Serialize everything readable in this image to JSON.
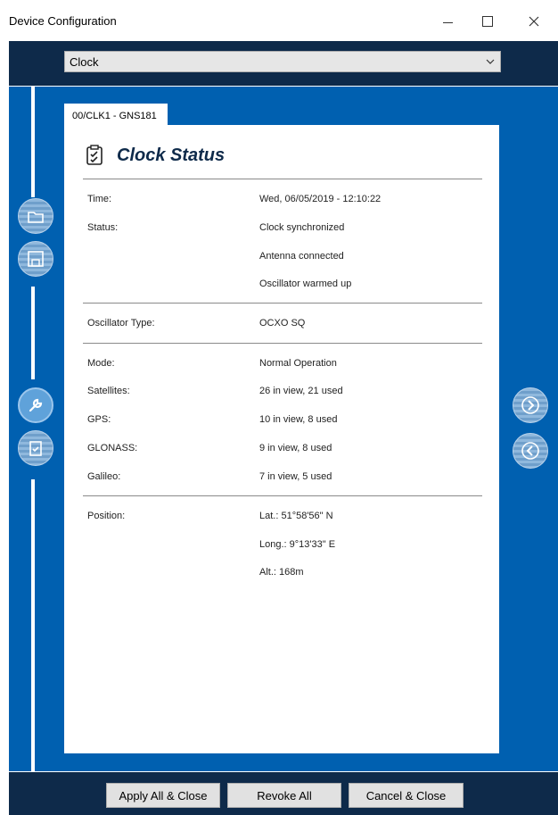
{
  "window": {
    "title": "Device Configuration"
  },
  "device_select": {
    "value": "Clock"
  },
  "tab": {
    "label": "00/CLK1 - GNS181"
  },
  "panel": {
    "title": "Clock Status"
  },
  "status": {
    "time_label": "Time:",
    "time_value": "Wed, 06/05/2019 - 12:10:22",
    "status_label": "Status:",
    "status_values": [
      "Clock synchronized",
      "Antenna connected",
      "Oscillator warmed up"
    ],
    "osc_label": "Oscillator Type:",
    "osc_value": "OCXO SQ",
    "mode_label": "Mode:",
    "mode_value": "Normal Operation",
    "sat_label": "Satellites:",
    "sat_value": "26 in view, 21 used",
    "gps_label": "GPS:",
    "gps_value": "10 in view, 8 used",
    "glonass_label": "GLONASS:",
    "glonass_value": "9 in view, 8 used",
    "galileo_label": "Galileo:",
    "galileo_value": "7 in view, 5 used",
    "pos_label": "Position:",
    "lat_value": "Lat.: 51°58'56\" N",
    "long_value": "Long.:  9°13'33\" E",
    "alt_value": "Alt.: 168m"
  },
  "sidebar_icons": [
    "open-folder-icon",
    "save-icon",
    "wrench-icon",
    "clipboard-check-icon"
  ],
  "right_icons": [
    "forward-icon",
    "back-icon"
  ],
  "footer": {
    "apply_label": "Apply All & Close",
    "revoke_label": "Revoke All",
    "cancel_label": "Cancel & Close"
  },
  "colors": {
    "blue": "#0060b0",
    "navy": "#0e2a4a",
    "title": "#0e2a4a"
  }
}
